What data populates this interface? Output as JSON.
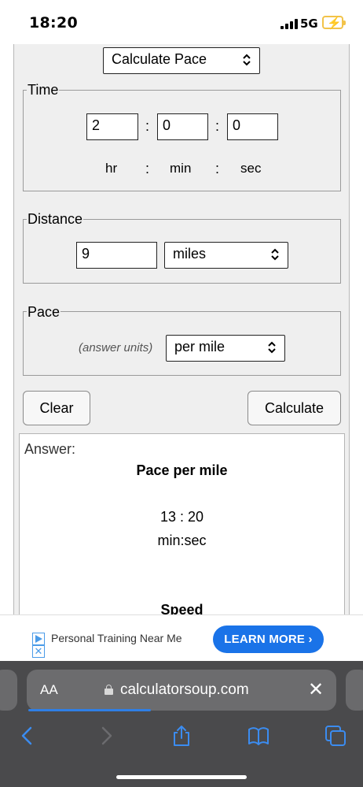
{
  "status_bar": {
    "time": "18:20",
    "network": "5G"
  },
  "mode_select": {
    "value": "Calculate Pace"
  },
  "time_section": {
    "legend": "Time",
    "hours": "2",
    "minutes": "0",
    "seconds": "0",
    "separator": ":",
    "unit_hr": "hr",
    "unit_min": "min",
    "unit_sec": "sec"
  },
  "distance_section": {
    "legend": "Distance",
    "value": "9",
    "unit": "miles"
  },
  "pace_section": {
    "legend": "Pace",
    "hint": "(answer units)",
    "unit": "per mile"
  },
  "buttons": {
    "clear": "Clear",
    "calculate": "Calculate"
  },
  "answer": {
    "label": "Answer:",
    "title": "Pace per mile",
    "value": "13 : 20",
    "format": "min:sec",
    "next_title": "Speed"
  },
  "ad": {
    "text": "Personal Training Near Me",
    "button": "LEARN MORE"
  },
  "browser": {
    "text_size": "AA",
    "url": "calculatorsoup.com",
    "accent": "#2f7fe6"
  }
}
